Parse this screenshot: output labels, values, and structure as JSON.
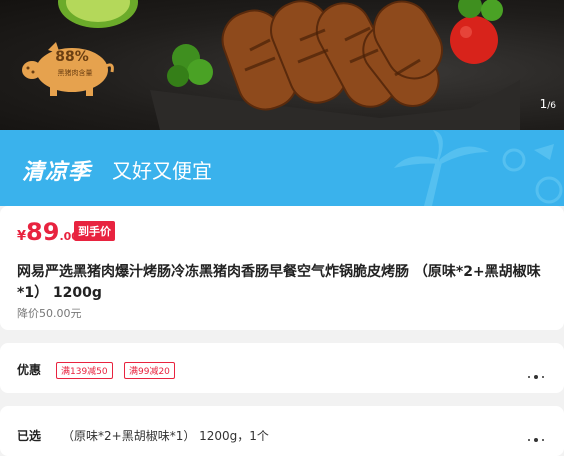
{
  "hero": {
    "badge_percent": "88%",
    "badge_caption": "黑猪肉含量",
    "page_current": "1",
    "page_total": "6"
  },
  "banner": {
    "title": "清凉季",
    "slogan": "又好又便宜"
  },
  "price": {
    "currency": "¥",
    "integer": "89",
    "decimal": ".00",
    "tag": "到手价",
    "original": "降价50.00元"
  },
  "product": {
    "title": "网易严选黑猪肉爆汁烤肠冷冻黑猪肉香肠早餐空气炸锅脆皮烤肠 （原味*2+黑胡椒味*1） 1200g"
  },
  "coupons": {
    "label": "优惠",
    "items": [
      "满139减50",
      "满99减20"
    ]
  },
  "selection": {
    "label": "已选",
    "value": "（原味*2+黑胡椒味*1） 1200g，1个"
  },
  "colors": {
    "accent": "#e8233f",
    "banner_bg": "#3ab2ec"
  }
}
